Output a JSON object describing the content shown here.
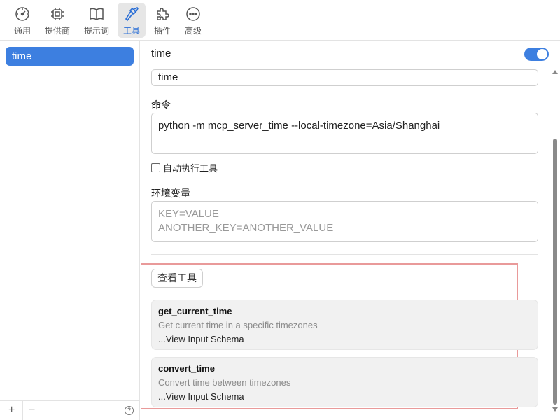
{
  "toolbar": {
    "items": [
      {
        "label": "通用",
        "icon": "dashboard-gauge-icon"
      },
      {
        "label": "提供商",
        "icon": "chip-icon"
      },
      {
        "label": "提示词",
        "icon": "book-icon"
      },
      {
        "label": "工具",
        "icon": "hammer-icon",
        "active": true
      },
      {
        "label": "插件",
        "icon": "puzzle-icon"
      },
      {
        "label": "高级",
        "icon": "more-dots-icon"
      }
    ]
  },
  "sidebar": {
    "items": [
      {
        "label": "time",
        "selected": true
      }
    ],
    "add_label": "+",
    "remove_label": "−",
    "help_label": "?"
  },
  "main": {
    "title": "time",
    "enabled": true,
    "name_value": "time",
    "command_label": "命令",
    "command_value": "python -m mcp_server_time --local-timezone=Asia/Shanghai",
    "auto_exec_label": "自动执行工具",
    "env_label": "环境变量",
    "env_placeholder_line1": "KEY=VALUE",
    "env_placeholder_line2": "ANOTHER_KEY=ANOTHER_VALUE",
    "view_tools_label": "查看工具",
    "tools": [
      {
        "name": "get_current_time",
        "description": "Get current time in a specific timezones",
        "link": "...View Input Schema"
      },
      {
        "name": "convert_time",
        "description": "Convert time between timezones",
        "link": "...View Input Schema"
      }
    ]
  },
  "colors": {
    "accent": "#3d7fe0",
    "highlight_border": "#e99a9a"
  }
}
